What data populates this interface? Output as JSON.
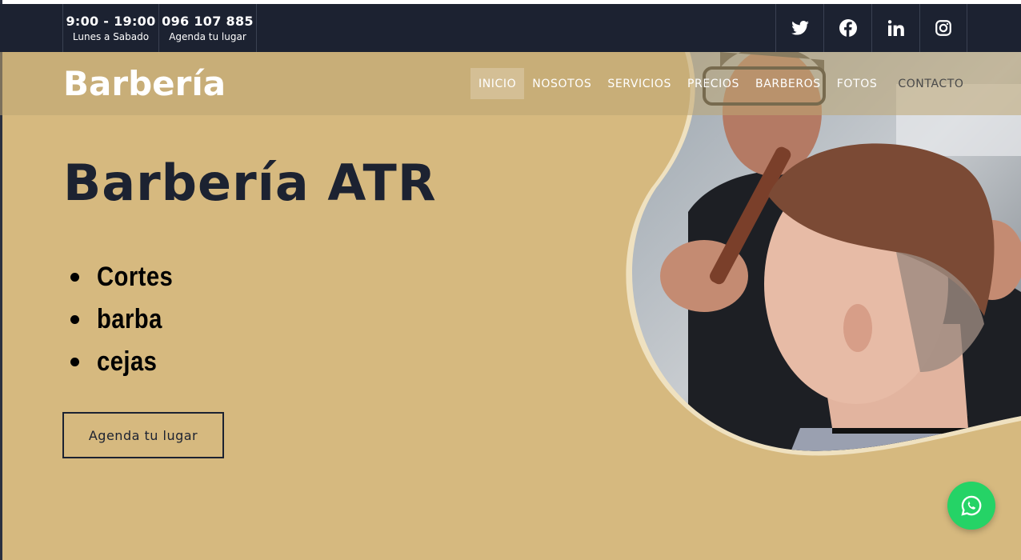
{
  "topbar": {
    "hours": {
      "main": "9:00 - 19:00",
      "sub": "Lunes a Sabado"
    },
    "phone": {
      "main": "096 107 885",
      "sub": "Agenda tu lugar"
    },
    "social": [
      {
        "icon": "twitter-icon"
      },
      {
        "icon": "facebook-icon"
      },
      {
        "icon": "linkedin-icon"
      },
      {
        "icon": "instagram-icon"
      }
    ]
  },
  "nav": {
    "brand": "Barbería",
    "items": [
      {
        "label": "INICIO"
      },
      {
        "label": "NOSOTOS"
      },
      {
        "label": "SERVICIOS"
      },
      {
        "label": "PRECIOS"
      },
      {
        "label": "BARBEROS"
      },
      {
        "label": "FOTOS"
      },
      {
        "label": "CONTACTO"
      }
    ]
  },
  "hero": {
    "title": "Barbería ATR",
    "services": [
      "Cortes",
      "barba",
      "cejas"
    ],
    "cta": "Agenda tu lugar"
  },
  "colors": {
    "dark": "#1c2231",
    "gold": "#d6b97f",
    "whatsapp": "#25d366"
  }
}
